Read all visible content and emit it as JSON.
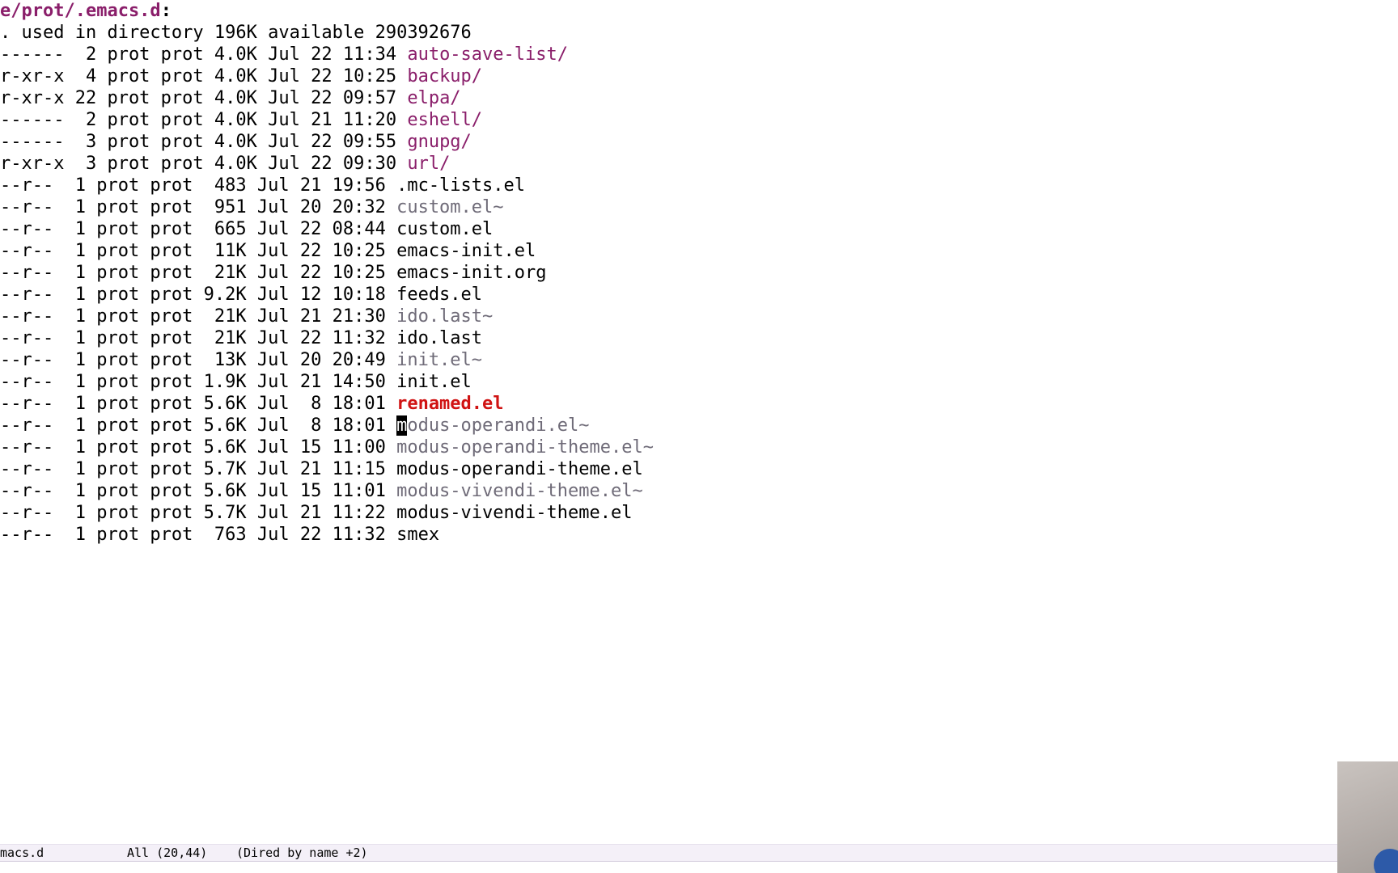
{
  "colors": {
    "directory": "#8a1e6a",
    "backup": "#6f6b78",
    "normal": "#000000",
    "renamed": "#d01313",
    "modeline_bg": "#f4f0f8"
  },
  "dired": {
    "header": "e/prot/.emacs.d",
    "header_colon": ":",
    "summary": ". used in directory 196K available 290392676",
    "entries": [
      {
        "meta": "------  2 prot prot 4.0K Jul 22 11:34 ",
        "name": "auto-save-list/",
        "kind": "directory"
      },
      {
        "meta": "r-xr-x  4 prot prot 4.0K Jul 22 10:25 ",
        "name": "backup/",
        "kind": "directory"
      },
      {
        "meta": "r-xr-x 22 prot prot 4.0K Jul 22 09:57 ",
        "name": "elpa/",
        "kind": "directory"
      },
      {
        "meta": "------  2 prot prot 4.0K Jul 21 11:20 ",
        "name": "eshell/",
        "kind": "directory"
      },
      {
        "meta": "------  3 prot prot 4.0K Jul 22 09:55 ",
        "name": "gnupg/",
        "kind": "directory"
      },
      {
        "meta": "r-xr-x  3 prot prot 4.0K Jul 22 09:30 ",
        "name": "url/",
        "kind": "directory"
      },
      {
        "meta": "--r--  1 prot prot  483 Jul 21 19:56 ",
        "name": ".mc-lists.el",
        "kind": "normal"
      },
      {
        "meta": "--r--  1 prot prot  951 Jul 20 20:32 ",
        "name": "custom.el~",
        "kind": "backup"
      },
      {
        "meta": "--r--  1 prot prot  665 Jul 22 08:44 ",
        "name": "custom.el",
        "kind": "normal"
      },
      {
        "meta": "--r--  1 prot prot  11K Jul 22 10:25 ",
        "name": "emacs-init.el",
        "kind": "normal"
      },
      {
        "meta": "--r--  1 prot prot  21K Jul 22 10:25 ",
        "name": "emacs-init.org",
        "kind": "normal"
      },
      {
        "meta": "--r--  1 prot prot 9.2K Jul 12 10:18 ",
        "name": "feeds.el",
        "kind": "normal"
      },
      {
        "meta": "--r--  1 prot prot  21K Jul 21 21:30 ",
        "name": "ido.last~",
        "kind": "backup"
      },
      {
        "meta": "--r--  1 prot prot  21K Jul 22 11:32 ",
        "name": "ido.last",
        "kind": "normal"
      },
      {
        "meta": "--r--  1 prot prot  13K Jul 20 20:49 ",
        "name": "init.el~",
        "kind": "backup"
      },
      {
        "meta": "--r--  1 prot prot 1.9K Jul 21 14:50 ",
        "name": "init.el",
        "kind": "normal"
      },
      {
        "meta": "--r--  1 prot prot 5.6K Jul  8 18:01 ",
        "name": "renamed.el",
        "kind": "renamed"
      },
      {
        "meta": "--r--  1 prot prot 5.6K Jul  8 18:01 ",
        "cursor_char": "m",
        "name": "odus-operandi.el~",
        "kind": "backup"
      },
      {
        "meta": "--r--  1 prot prot 5.6K Jul 15 11:00 ",
        "name": "modus-operandi-theme.el~",
        "kind": "backup"
      },
      {
        "meta": "--r--  1 prot prot 5.7K Jul 21 11:15 ",
        "name": "modus-operandi-theme.el",
        "kind": "normal"
      },
      {
        "meta": "--r--  1 prot prot 5.6K Jul 15 11:01 ",
        "name": "modus-vivendi-theme.el~",
        "kind": "backup"
      },
      {
        "meta": "--r--  1 prot prot 5.7K Jul 21 11:22 ",
        "name": "modus-vivendi-theme.el",
        "kind": "normal"
      },
      {
        "meta": "--r--  1 prot prot  763 Jul 22 11:32 ",
        "name": "smex",
        "kind": "normal"
      }
    ]
  },
  "modeline": {
    "buffer_name": "macs.d",
    "position": "All (20,44)",
    "mode": "(Dired by name +2)"
  }
}
